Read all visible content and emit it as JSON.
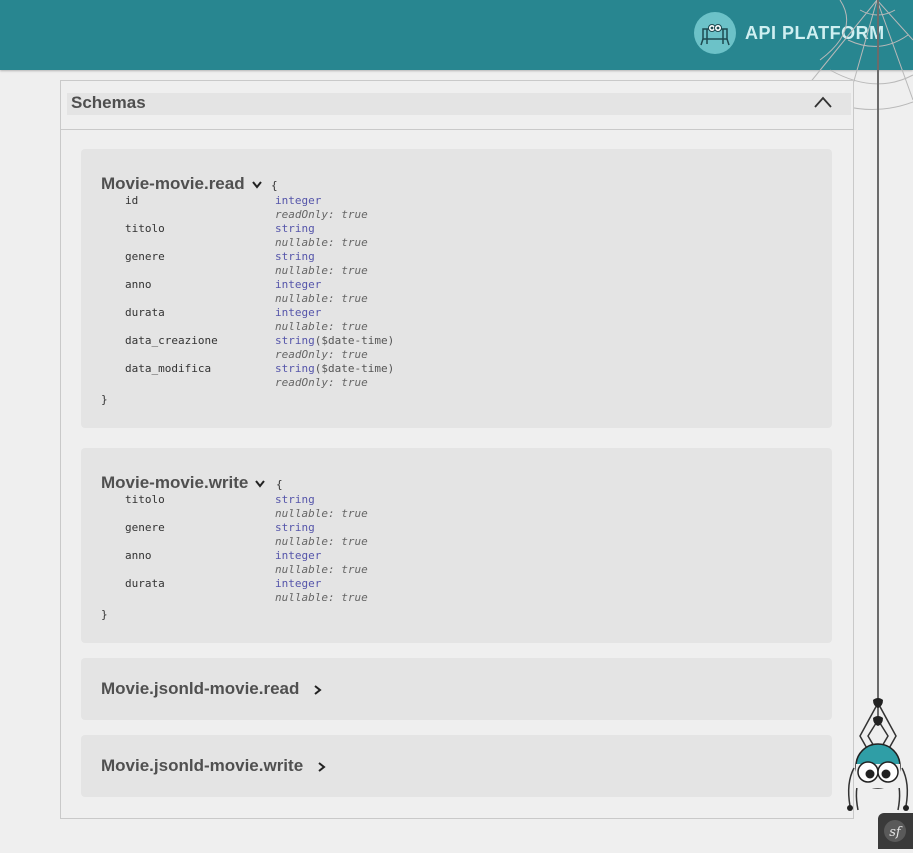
{
  "header": {
    "brand": "API PLATFORM"
  },
  "schemas": {
    "title": "Schemas",
    "models": [
      {
        "name": "Movie-movie.read",
        "expanded": true,
        "open_brace": "{",
        "close_brace": "}",
        "properties": [
          {
            "name": "id",
            "type": "integer",
            "extra_key": "readOnly:",
            "extra_val": "true"
          },
          {
            "name": "titolo",
            "type": "string",
            "extra_key": "nullable:",
            "extra_val": "true"
          },
          {
            "name": "genere",
            "type": "string",
            "extra_key": "nullable:",
            "extra_val": "true"
          },
          {
            "name": "anno",
            "type": "integer",
            "extra_key": "nullable:",
            "extra_val": "true"
          },
          {
            "name": "durata",
            "type": "integer",
            "extra_key": "nullable:",
            "extra_val": "true"
          },
          {
            "name": "data_creazione",
            "type": "string",
            "format": "($date-time)",
            "extra_key": "readOnly:",
            "extra_val": "true"
          },
          {
            "name": "data_modifica",
            "type": "string",
            "format": "($date-time)",
            "extra_key": "readOnly:",
            "extra_val": "true"
          }
        ]
      },
      {
        "name": "Movie-movie.write",
        "expanded": true,
        "open_brace": "{",
        "close_brace": "}",
        "properties": [
          {
            "name": "titolo",
            "type": "string",
            "extra_key": "nullable:",
            "extra_val": "true"
          },
          {
            "name": "genere",
            "type": "string",
            "extra_key": "nullable:",
            "extra_val": "true"
          },
          {
            "name": "anno",
            "type": "integer",
            "extra_key": "nullable:",
            "extra_val": "true"
          },
          {
            "name": "durata",
            "type": "integer",
            "extra_key": "nullable:",
            "extra_val": "true"
          }
        ]
      },
      {
        "name": "Movie.jsonld-movie.read",
        "expanded": false
      },
      {
        "name": "Movie.jsonld-movie.write",
        "expanded": false
      }
    ]
  },
  "colors": {
    "header": "#288690",
    "accent": "#6cc2c8",
    "type_text": "#5555aa"
  },
  "icons": {
    "collapse": "chevron-up-icon",
    "expand": "chevron-down-icon",
    "collapsed": "chevron-right-icon",
    "framework": "symfony-icon"
  }
}
